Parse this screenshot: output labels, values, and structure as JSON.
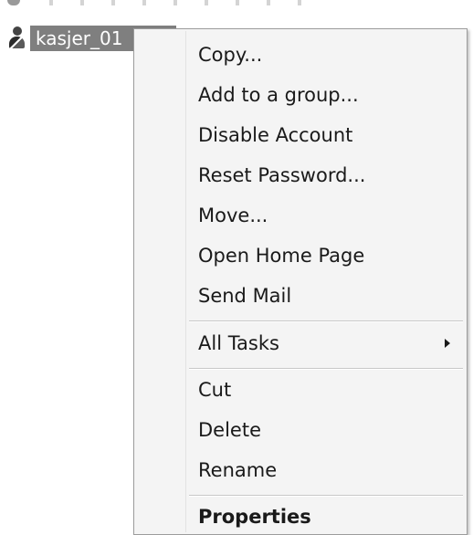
{
  "list": {
    "selected_item": {
      "label": "kasjer_01",
      "icon": "user-icon"
    }
  },
  "context_menu": {
    "items": [
      {
        "label": "Copy..."
      },
      {
        "label": "Add to a group..."
      },
      {
        "label": "Disable Account"
      },
      {
        "label": "Reset Password..."
      },
      {
        "label": "Move..."
      },
      {
        "label": "Open Home Page"
      },
      {
        "label": "Send Mail"
      },
      {
        "label": "All Tasks",
        "submenu": true,
        "icon": "submenu-arrow-icon"
      },
      {
        "label": "Cut"
      },
      {
        "label": "Delete"
      },
      {
        "label": "Rename"
      },
      {
        "label": "Properties",
        "bold": true
      }
    ]
  },
  "colors": {
    "selection_background": "#7f7f7f",
    "menu_background": "#f4f4f4",
    "menu_border": "#9c9c9c",
    "separator": "#c8c8c8"
  }
}
